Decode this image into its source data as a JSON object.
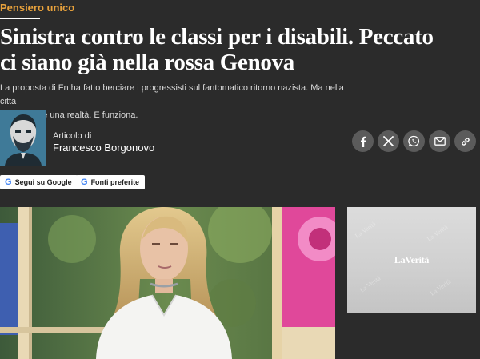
{
  "section": {
    "kicker": "Pensiero unico"
  },
  "article": {
    "headline_line1": "Sinistra contro le classi per i disabili. Peccato",
    "headline_line2": "ci siano già nella rossa Genova",
    "subtitle_line1": "La proposta di Fn ha fatto berciare i progressisti sul fantomatico ritorno nazista. Ma nella città",
    "subtitle_line2": "della Salis è una realtà. E funziona."
  },
  "author": {
    "kicker": "Articolo di",
    "name": "Francesco Borgonovo"
  },
  "share": {
    "icons": [
      "facebook-icon",
      "x-icon",
      "whatsapp-icon",
      "mail-icon",
      "link-icon"
    ]
  },
  "follow": {
    "google_label": "Segui su Google",
    "preferred_label": "Fonti preferite"
  },
  "ad": {
    "logo_text": "LaVerità",
    "watermark": "La Verità"
  },
  "colors": {
    "background": "#2b2b2b",
    "kicker": "#e8a23c",
    "share_button": "#5b5b5b"
  }
}
